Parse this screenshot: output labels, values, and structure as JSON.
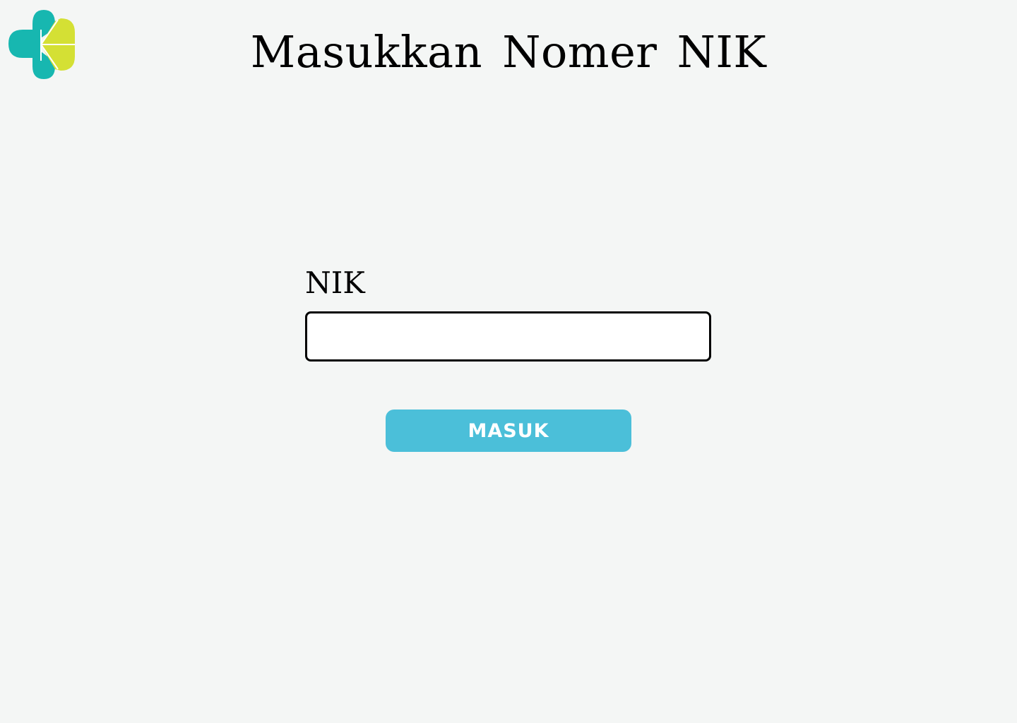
{
  "header": {
    "title": "Masukkan Nomer NIK",
    "logo_icon": "kemenkes-logo-icon"
  },
  "form": {
    "nik_label": "NIK",
    "nik_value": "",
    "nik_placeholder": "",
    "submit_label": "MASUK"
  },
  "colors": {
    "background": "#f4f6f5",
    "button": "#4bbfd9",
    "logo_teal": "#17b7b0",
    "logo_lime": "#d4e034"
  }
}
